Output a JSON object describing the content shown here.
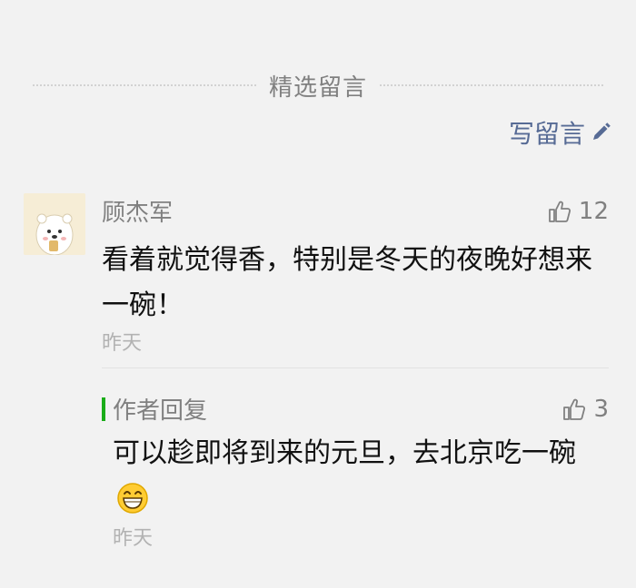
{
  "section": {
    "title": "精选留言"
  },
  "write_link": {
    "label": "写留言",
    "icon": "pencil-icon"
  },
  "comment": {
    "author": "顾杰军",
    "likes": "12",
    "text": "看着就觉得香，特别是冬天的夜晚好想来一碗！",
    "time": "昨天",
    "avatar": "cartoon-bear-avatar"
  },
  "reply": {
    "label": "作者回复",
    "likes": "3",
    "text": "可以趁即将到来的元旦，去北京吃一碗",
    "emoji": "grinning-emoji",
    "time": "昨天"
  },
  "colors": {
    "link": "#576b95",
    "muted": "#808080",
    "reply_bar": "#1aad19",
    "background": "#f2f2f2"
  }
}
